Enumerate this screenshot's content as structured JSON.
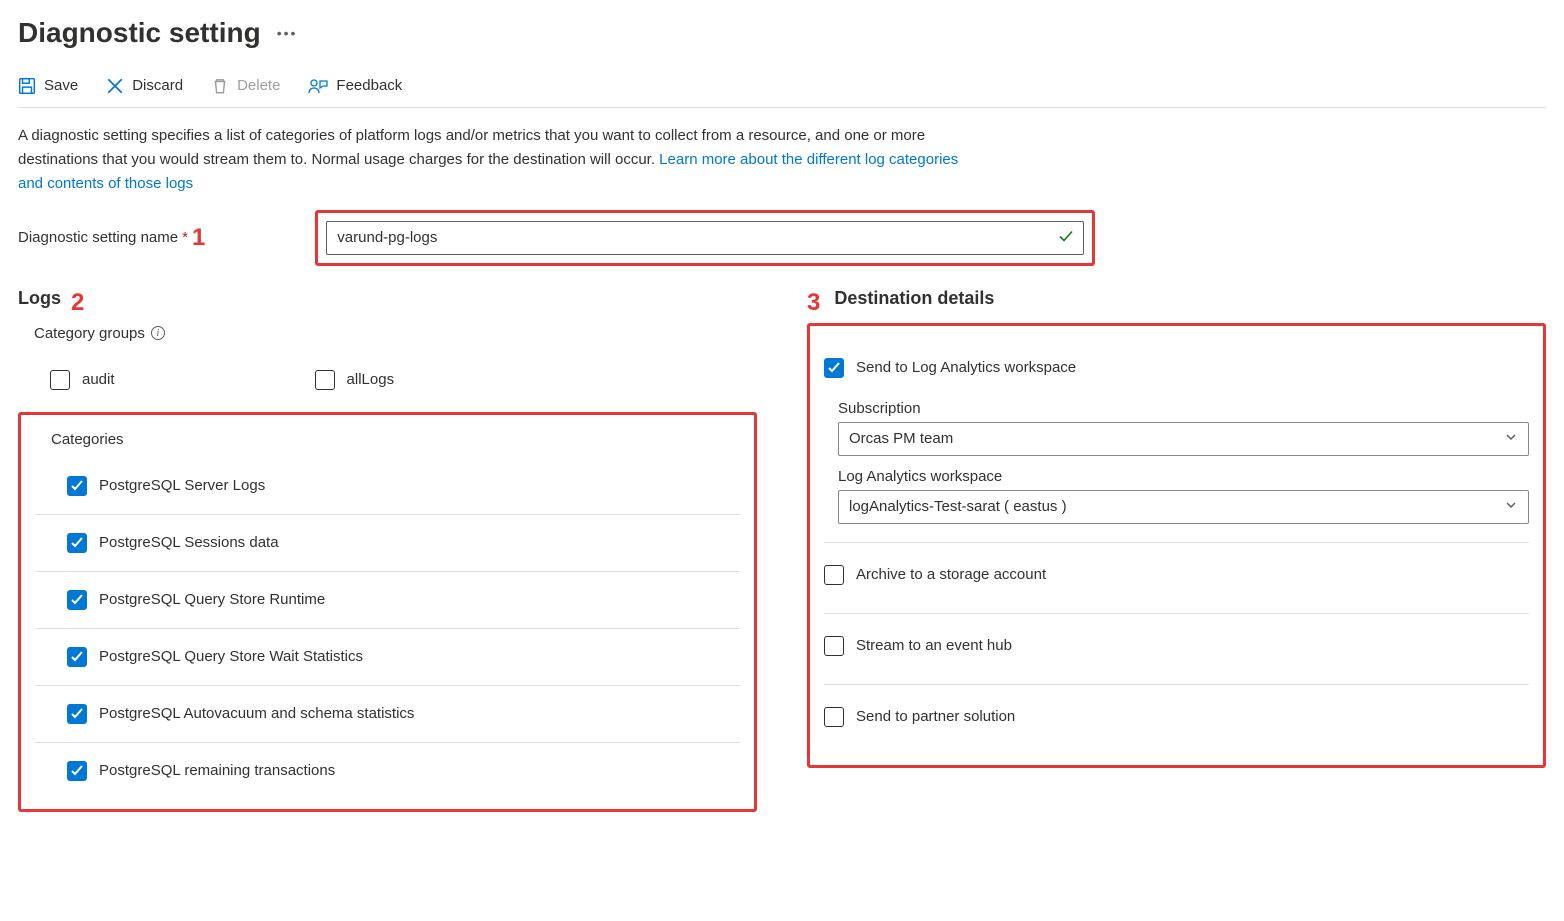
{
  "page": {
    "title": "Diagnostic setting"
  },
  "toolbar": {
    "save": "Save",
    "discard": "Discard",
    "delete": "Delete",
    "feedback": "Feedback"
  },
  "description": {
    "text": "A diagnostic setting specifies a list of categories of platform logs and/or metrics that you want to collect from a resource, and one or more destinations that you would stream them to. Normal usage charges for the destination will occur. ",
    "link": "Learn more about the different log categories and contents of those logs"
  },
  "name_field": {
    "label": "Diagnostic setting name",
    "value": "varund-pg-logs",
    "annotation": "1"
  },
  "logs": {
    "title": "Logs",
    "annotation": "2",
    "groups_label": "Category groups",
    "groups": [
      {
        "label": "audit",
        "checked": false
      },
      {
        "label": "allLogs",
        "checked": false
      }
    ],
    "categories_label": "Categories",
    "categories": [
      {
        "label": "PostgreSQL Server Logs",
        "checked": true
      },
      {
        "label": "PostgreSQL Sessions data",
        "checked": true
      },
      {
        "label": "PostgreSQL Query Store Runtime",
        "checked": true
      },
      {
        "label": "PostgreSQL Query Store Wait Statistics",
        "checked": true
      },
      {
        "label": "PostgreSQL Autovacuum and schema statistics",
        "checked": true
      },
      {
        "label": "PostgreSQL remaining transactions",
        "checked": true
      }
    ]
  },
  "destination": {
    "title": "Destination details",
    "annotation": "3",
    "law": {
      "label": "Send to Log Analytics workspace",
      "checked": true,
      "subscription_label": "Subscription",
      "subscription_value": "Orcas PM team",
      "workspace_label": "Log Analytics workspace",
      "workspace_value": "logAnalytics-Test-sarat ( eastus )"
    },
    "storage": {
      "label": "Archive to a storage account",
      "checked": false
    },
    "eventhub": {
      "label": "Stream to an event hub",
      "checked": false
    },
    "partner": {
      "label": "Send to partner solution",
      "checked": false
    }
  }
}
